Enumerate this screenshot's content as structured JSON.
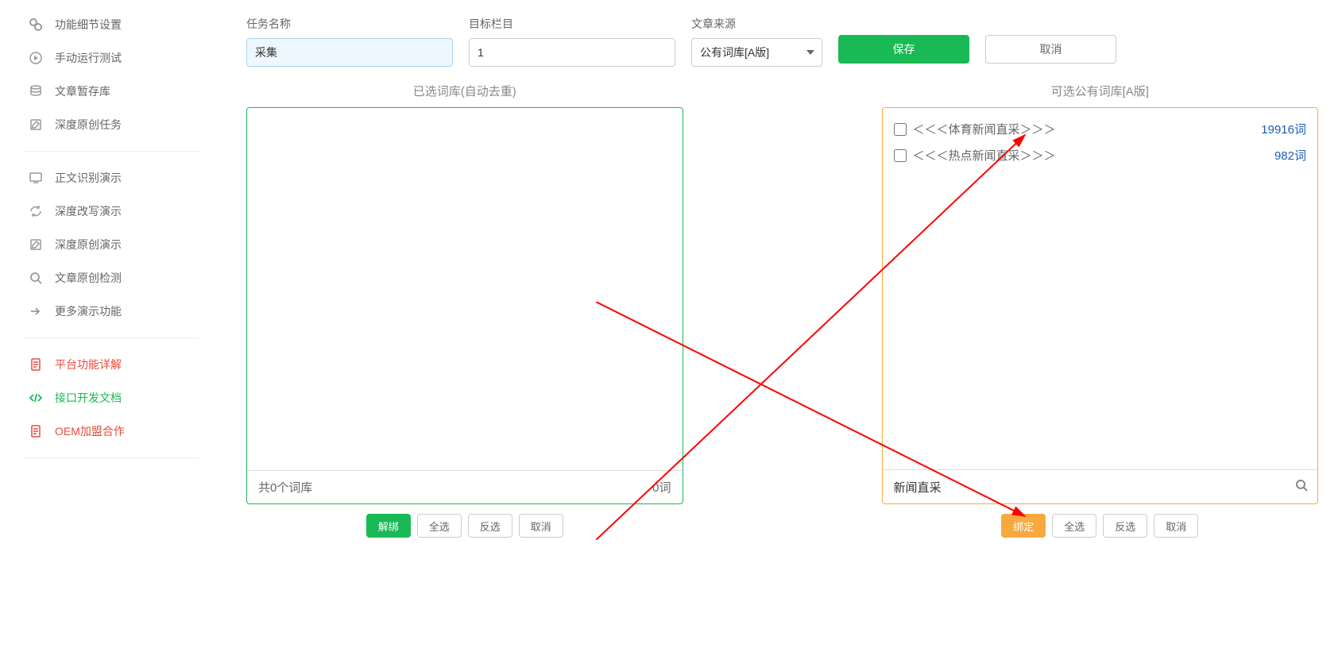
{
  "sidebar": {
    "items": [
      {
        "label": "功能细节设置"
      },
      {
        "label": "手动运行测试"
      },
      {
        "label": "文章暂存库"
      },
      {
        "label": "深度原创任务"
      }
    ],
    "demo_items": [
      {
        "label": "正文识别演示"
      },
      {
        "label": "深度改写演示"
      },
      {
        "label": "深度原创演示"
      },
      {
        "label": "文章原创检测"
      },
      {
        "label": "更多演示功能"
      }
    ],
    "doc_items": [
      {
        "label": "平台功能详解",
        "cls": "red"
      },
      {
        "label": "接口开发文档",
        "cls": "green"
      },
      {
        "label": "OEM加盟合作",
        "cls": "red"
      }
    ]
  },
  "form": {
    "task_name_label": "任务名称",
    "task_name_value": "采集",
    "target_label": "目标栏目",
    "target_value": "1",
    "source_label": "文章来源",
    "source_value": "公有词库[A版]",
    "save_label": "保存",
    "cancel_label": "取消"
  },
  "left_panel": {
    "title": "已选词库(自动去重)",
    "footer_left": "共0个词库",
    "footer_right": "0词",
    "buttons": {
      "unbind": "解绑",
      "select_all": "全选",
      "invert": "反选",
      "cancel": "取消"
    }
  },
  "right_panel": {
    "title": "可选公有词库[A版]",
    "items": [
      {
        "name": "＜＜＜体育新闻直采＞＞＞",
        "count": "19916词"
      },
      {
        "name": "＜＜＜热点新闻直采＞＞＞",
        "count": "982词"
      }
    ],
    "search_value": "新闻直采",
    "buttons": {
      "bind": "绑定",
      "select_all": "全选",
      "invert": "反选",
      "cancel": "取消"
    }
  }
}
